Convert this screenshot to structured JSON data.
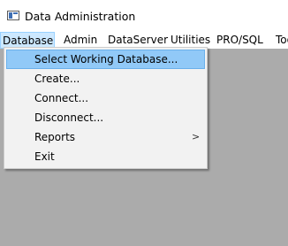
{
  "window": {
    "title": "Data Administration",
    "icon": "application-window-icon"
  },
  "menubar": {
    "items": [
      {
        "label": "Database"
      },
      {
        "label": "Admin"
      },
      {
        "label": "DataServer"
      },
      {
        "label": "Utilities"
      },
      {
        "label": "PRO/SQL"
      },
      {
        "label": "Too"
      }
    ]
  },
  "database_menu": {
    "items": [
      {
        "label": "Select Working Database..."
      },
      {
        "label": "Create..."
      },
      {
        "label": "Connect..."
      },
      {
        "label": "Disconnect..."
      },
      {
        "label": "Reports",
        "submenu_indicator": ">"
      },
      {
        "label": "Exit"
      }
    ]
  },
  "colors": {
    "highlight": "#91c9f7",
    "menubar_active": "#cce8ff",
    "workspace": "#ababab"
  }
}
